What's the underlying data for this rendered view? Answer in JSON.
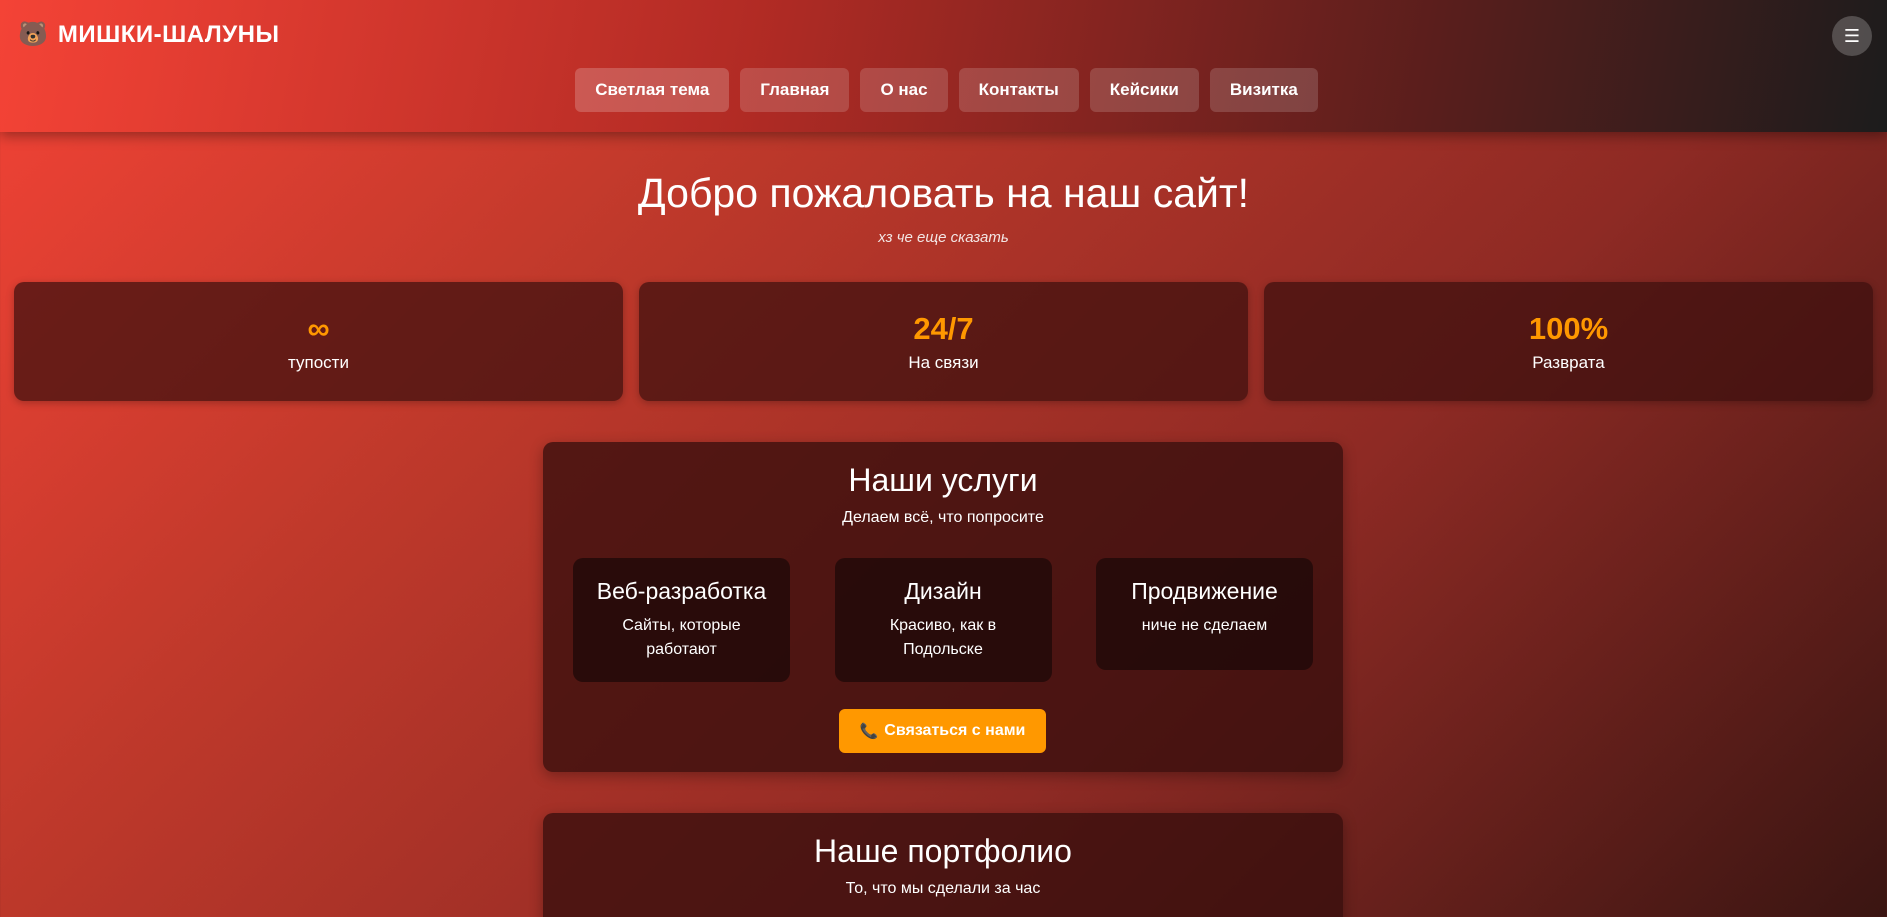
{
  "header": {
    "logo_icon": "🐻",
    "logo_text": "МИШКИ-ШАЛУНЫ",
    "menu_icon": "☰",
    "nav": [
      {
        "label": "Светлая тема"
      },
      {
        "label": "Главная"
      },
      {
        "label": "О нас"
      },
      {
        "label": "Контакты"
      },
      {
        "label": "Кейсики"
      },
      {
        "label": "Визитка"
      }
    ]
  },
  "hero": {
    "title": "Добро пожаловать на наш сайт!",
    "subtitle": "хз че еще сказать"
  },
  "stats": [
    {
      "value": "∞",
      "label": "тупости"
    },
    {
      "value": "24/7",
      "label": "На связи"
    },
    {
      "value": "100%",
      "label": "Разврата"
    }
  ],
  "services": {
    "title": "Наши услуги",
    "subtitle": "Делаем всё, что попросите",
    "items": [
      {
        "title": "Веб-разработка",
        "desc": "Сайты, которые работают"
      },
      {
        "title": "Дизайн",
        "desc": "Красиво, как в Подольске"
      },
      {
        "title": "Продвижение",
        "desc": "ниче не сделаем"
      }
    ],
    "cta_icon": "📞",
    "cta_label": "Связаться с нами"
  },
  "portfolio": {
    "title": "Наше портфолио",
    "subtitle": "То, что мы сделали за час"
  },
  "colors": {
    "accent": "#ff9800",
    "bg_start": "#f44336",
    "bg_end": "#3a1512"
  }
}
